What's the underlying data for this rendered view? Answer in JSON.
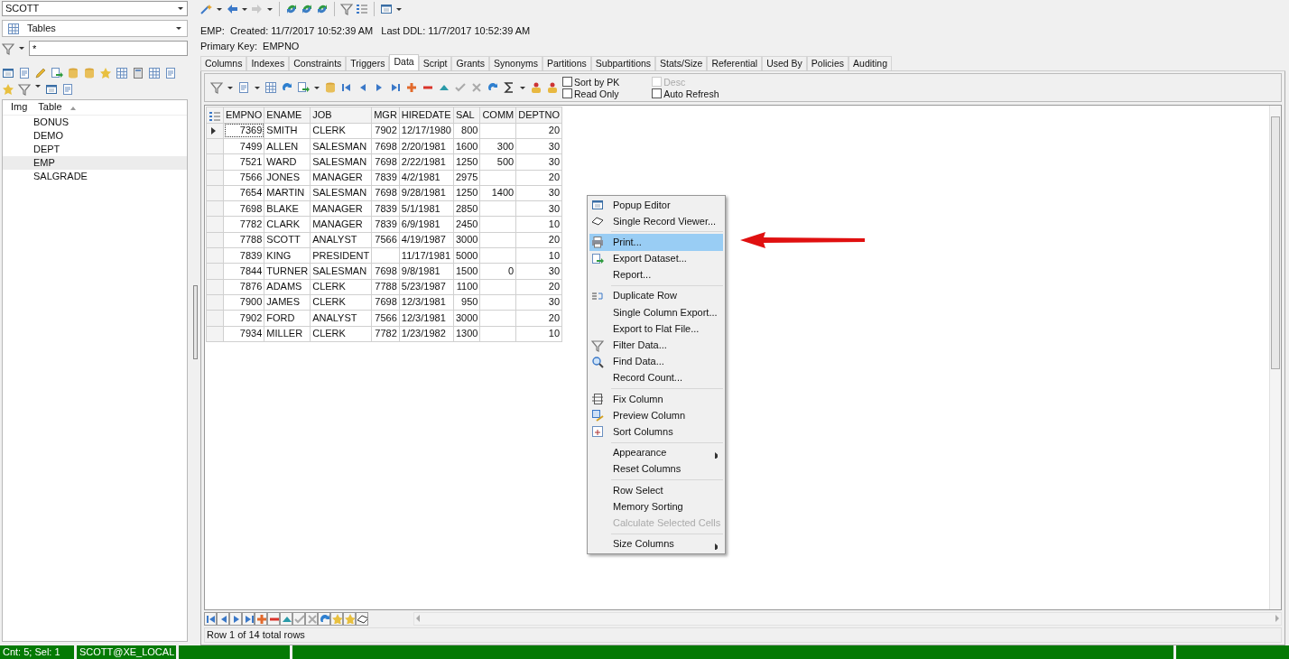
{
  "left_panel": {
    "schema_select": {
      "value": "SCOTT"
    },
    "type_select": {
      "value": "Tables"
    },
    "filter_field": {
      "value": "*"
    },
    "list": {
      "columns": [
        "Img",
        "Table"
      ],
      "items": [
        {
          "label": "BONUS",
          "selected": false
        },
        {
          "label": "DEMO",
          "selected": false
        },
        {
          "label": "DEPT",
          "selected": false
        },
        {
          "label": "EMP",
          "selected": true
        },
        {
          "label": "SALGRADE",
          "selected": false
        }
      ]
    }
  },
  "object_info": {
    "summary": "EMP:  Created: 11/7/2017 10:52:39 AM   Last DDL: 11/7/2017 10:52:39 AM",
    "primary_key": "Primary Key:  EMPNO"
  },
  "tabs": [
    {
      "label": "Columns",
      "selected": false
    },
    {
      "label": "Indexes",
      "selected": false
    },
    {
      "label": "Constraints",
      "selected": false
    },
    {
      "label": "Triggers",
      "selected": false
    },
    {
      "label": "Data",
      "selected": true
    },
    {
      "label": "Script",
      "selected": false
    },
    {
      "label": "Grants",
      "selected": false
    },
    {
      "label": "Synonyms",
      "selected": false
    },
    {
      "label": "Partitions",
      "selected": false
    },
    {
      "label": "Subpartitions",
      "selected": false
    },
    {
      "label": "Stats/Size",
      "selected": false
    },
    {
      "label": "Referential",
      "selected": false
    },
    {
      "label": "Used By",
      "selected": false
    },
    {
      "label": "Policies",
      "selected": false
    },
    {
      "label": "Auditing",
      "selected": false
    }
  ],
  "data_options": [
    {
      "label": "Sort by PK",
      "checked": false,
      "disabled": false
    },
    {
      "label": "Read Only",
      "checked": false,
      "disabled": false
    },
    {
      "label": "Desc",
      "checked": false,
      "disabled": true
    },
    {
      "label": "Auto Refresh",
      "checked": false,
      "disabled": false
    }
  ],
  "grid": {
    "columns": [
      {
        "label": "EMPNO",
        "right_aligned": true
      },
      {
        "label": "ENAME",
        "right_aligned": false
      },
      {
        "label": "JOB",
        "right_aligned": false
      },
      {
        "label": "MGR",
        "right_aligned": true
      },
      {
        "label": "HIREDATE",
        "right_aligned": false
      },
      {
        "label": "SAL",
        "right_aligned": true
      },
      {
        "label": "COMM",
        "right_aligned": true
      },
      {
        "label": "DEPTNO",
        "right_aligned": true
      }
    ],
    "rows": [
      {
        "current": true,
        "cells": [
          "7369",
          "SMITH",
          "CLERK",
          "7902",
          "12/17/1980",
          "800",
          null,
          "20"
        ]
      },
      {
        "current": false,
        "cells": [
          "7499",
          "ALLEN",
          "SALESMAN",
          "7698",
          "2/20/1981",
          "1600",
          "300",
          "30"
        ]
      },
      {
        "current": false,
        "cells": [
          "7521",
          "WARD",
          "SALESMAN",
          "7698",
          "2/22/1981",
          "1250",
          "500",
          "30"
        ]
      },
      {
        "current": false,
        "cells": [
          "7566",
          "JONES",
          "MANAGER",
          "7839",
          "4/2/1981",
          "2975",
          null,
          "20"
        ]
      },
      {
        "current": false,
        "cells": [
          "7654",
          "MARTIN",
          "SALESMAN",
          "7698",
          "9/28/1981",
          "1250",
          "1400",
          "30"
        ]
      },
      {
        "current": false,
        "cells": [
          "7698",
          "BLAKE",
          "MANAGER",
          "7839",
          "5/1/1981",
          "2850",
          null,
          "30"
        ]
      },
      {
        "current": false,
        "cells": [
          "7782",
          "CLARK",
          "MANAGER",
          "7839",
          "6/9/1981",
          "2450",
          null,
          "10"
        ]
      },
      {
        "current": false,
        "cells": [
          "7788",
          "SCOTT",
          "ANALYST",
          "7566",
          "4/19/1987",
          "3000",
          null,
          "20"
        ]
      },
      {
        "current": false,
        "cells": [
          "7839",
          "KING",
          "PRESIDENT",
          null,
          "11/17/1981",
          "5000",
          null,
          "10"
        ]
      },
      {
        "current": false,
        "cells": [
          "7844",
          "TURNER",
          "SALESMAN",
          "7698",
          "9/8/1981",
          "1500",
          "0",
          "30"
        ]
      },
      {
        "current": false,
        "cells": [
          "7876",
          "ADAMS",
          "CLERK",
          "7788",
          "5/23/1987",
          "1100",
          null,
          "20"
        ]
      },
      {
        "current": false,
        "cells": [
          "7900",
          "JAMES",
          "CLERK",
          "7698",
          "12/3/1981",
          "950",
          null,
          "30"
        ]
      },
      {
        "current": false,
        "cells": [
          "7902",
          "FORD",
          "ANALYST",
          "7566",
          "12/3/1981",
          "3000",
          null,
          "20"
        ]
      },
      {
        "current": false,
        "cells": [
          "7934",
          "MILLER",
          "CLERK",
          "7782",
          "1/23/1982",
          "1300",
          null,
          "10"
        ]
      }
    ]
  },
  "grid_status": "Row 1 of 14 total rows",
  "context_menu": {
    "groups": [
      [
        {
          "label": "Popup Editor",
          "selected": false,
          "disabled": false,
          "submenu": false
        },
        {
          "label": "Single Record Viewer...",
          "selected": false,
          "disabled": false,
          "submenu": false
        }
      ],
      [
        {
          "label": "Print...",
          "selected": true,
          "disabled": false,
          "submenu": false
        },
        {
          "label": "Export Dataset...",
          "selected": false,
          "disabled": false,
          "submenu": false
        },
        {
          "label": "Report...",
          "selected": false,
          "disabled": false,
          "submenu": false
        }
      ],
      [
        {
          "label": "Duplicate Row",
          "selected": false,
          "disabled": false,
          "submenu": false
        },
        {
          "label": "Single Column Export...",
          "selected": false,
          "disabled": false,
          "submenu": false
        },
        {
          "label": "Export to Flat File...",
          "selected": false,
          "disabled": false,
          "submenu": false
        },
        {
          "label": "Filter Data...",
          "selected": false,
          "disabled": false,
          "submenu": false
        },
        {
          "label": "Find Data...",
          "selected": false,
          "disabled": false,
          "submenu": false
        },
        {
          "label": "Record Count...",
          "selected": false,
          "disabled": false,
          "submenu": false
        }
      ],
      [
        {
          "label": "Fix Column",
          "selected": false,
          "disabled": false,
          "submenu": false
        },
        {
          "label": "Preview Column",
          "selected": false,
          "disabled": false,
          "submenu": false
        },
        {
          "label": "Sort Columns",
          "selected": false,
          "disabled": false,
          "submenu": false
        }
      ],
      [
        {
          "label": "Appearance",
          "selected": false,
          "disabled": false,
          "submenu": true
        },
        {
          "label": "Reset Columns",
          "selected": false,
          "disabled": false,
          "submenu": false
        }
      ],
      [
        {
          "label": "Row Select",
          "selected": false,
          "disabled": false,
          "submenu": false
        },
        {
          "label": "Memory Sorting",
          "selected": false,
          "disabled": false,
          "submenu": false
        },
        {
          "label": "Calculate Selected Cells",
          "selected": false,
          "disabled": true,
          "submenu": false
        }
      ],
      [
        {
          "label": "Size Columns",
          "selected": false,
          "disabled": false,
          "submenu": true
        }
      ]
    ]
  },
  "status_bar": [
    "Cnt: 5; Sel: 1",
    "SCOTT@XE_LOCAL"
  ]
}
